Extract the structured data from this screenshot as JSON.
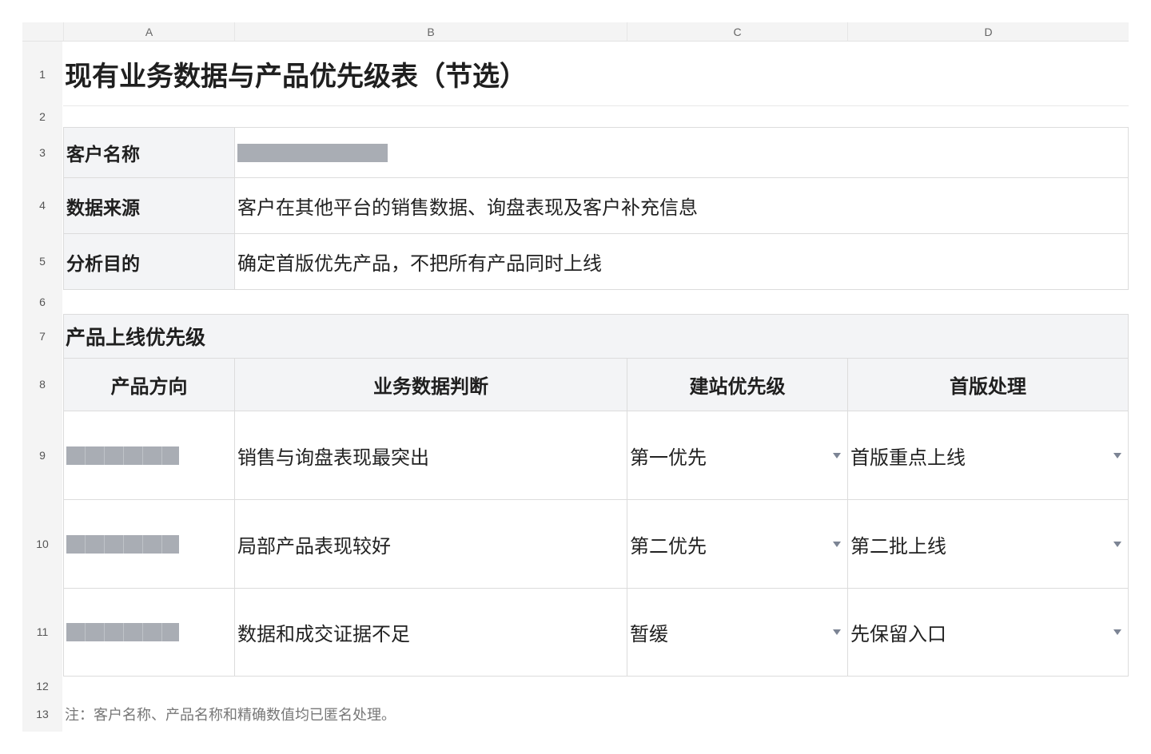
{
  "columns": [
    "A",
    "B",
    "C",
    "D"
  ],
  "rows": [
    "1",
    "2",
    "3",
    "4",
    "5",
    "6",
    "7",
    "8",
    "9",
    "10",
    "11",
    "12",
    "13"
  ],
  "title": "现有业务数据与产品优先级表（节选）",
  "info": [
    {
      "label": "客户名称",
      "value": "",
      "redacted": true
    },
    {
      "label": "数据来源",
      "value": "客户在其他平台的销售数据、询盘表现及客户补充信息",
      "redacted": false
    },
    {
      "label": "分析目的",
      "value": "确定首版优先产品，不把所有产品同时上线",
      "redacted": false
    }
  ],
  "section_title": "产品上线优先级",
  "table": {
    "headers": [
      "产品方向",
      "业务数据判断",
      "建站优先级",
      "首版处理"
    ],
    "rows": [
      {
        "product": "",
        "product_redacted": true,
        "judgement": "销售与询盘表现最突出",
        "priority": "第一优先",
        "handling": "首版重点上线"
      },
      {
        "product": "",
        "product_redacted": true,
        "judgement": "局部产品表现较好",
        "priority": "第二优先",
        "handling": "第二批上线"
      },
      {
        "product": "",
        "product_redacted": true,
        "judgement": "数据和成交证据不足",
        "priority": "暂缓",
        "handling": "先保留入口"
      }
    ]
  },
  "note": "注：客户名称、产品名称和精确数值均已匿名处理。",
  "colors": {
    "header_fill": "#f3f4f6",
    "redaction": "#a9adb4",
    "grid": "#dcdcdc"
  }
}
